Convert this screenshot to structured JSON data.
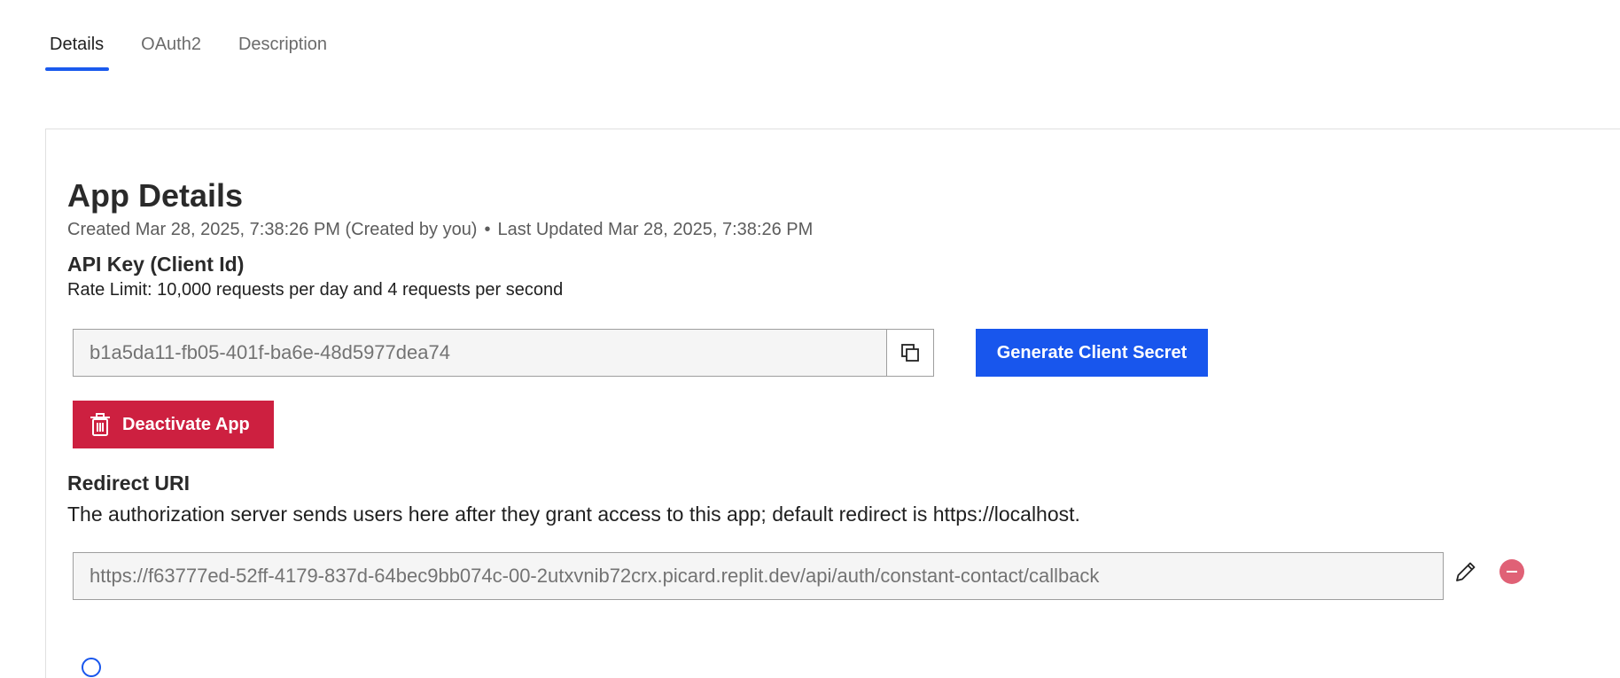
{
  "tabs": [
    {
      "label": "Details",
      "active": true
    },
    {
      "label": "OAuth2",
      "active": false
    },
    {
      "label": "Description",
      "active": false
    }
  ],
  "app_details": {
    "title": "App Details",
    "created": "Created Mar 28, 2025, 7:38:26 PM (Created by you)",
    "separator": "•",
    "last_updated": "Last Updated Mar 28, 2025, 7:38:26 PM"
  },
  "api_key": {
    "title": "API Key (Client Id)",
    "rate_limit": "Rate Limit: 10,000 requests per day and 4 requests per second",
    "value": "b1a5da11-fb05-401f-ba6e-48d5977dea74",
    "copy_icon": "copy-icon",
    "generate_label": "Generate Client Secret"
  },
  "deactivate": {
    "label": "Deactivate App",
    "icon": "trash-icon"
  },
  "redirect": {
    "title": "Redirect URI",
    "description": "The authorization server sends users here after they grant access to this app; default redirect is https://localhost.",
    "value": "https://f63777ed-52ff-4179-837d-64bec9bb074c-00-2utxvnib72crx.picard.replit.dev/api/auth/constant-contact/callback",
    "edit_icon": "pencil-icon",
    "remove_icon": "minus-circle-icon"
  },
  "colors": {
    "accent": "#1856ed",
    "danger": "#cd2040",
    "remove": "#e06176"
  }
}
